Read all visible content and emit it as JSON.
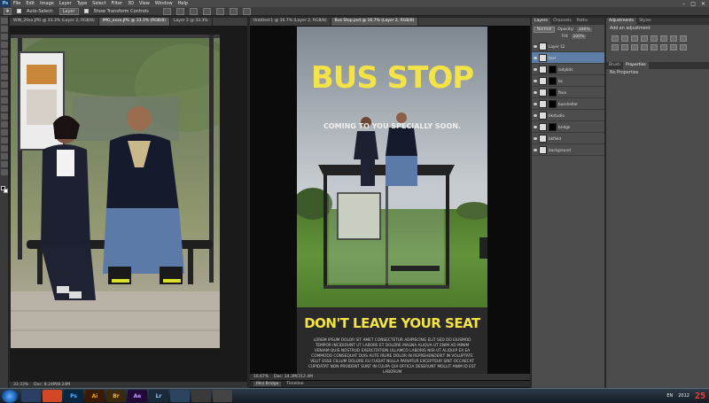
{
  "menubar": {
    "app_logo": "Ps",
    "items": [
      "File",
      "Edit",
      "Image",
      "Layer",
      "Type",
      "Select",
      "Filter",
      "3D",
      "View",
      "Window",
      "Help"
    ],
    "controls": [
      "–",
      "□",
      "✕"
    ]
  },
  "options_bar": {
    "auto_select_label": "Auto-Select:",
    "auto_select_value": "Layer",
    "transform_label": "Show Transform Controls"
  },
  "doc1": {
    "tabs": [
      "WIN_20xx.JPG @ 33.3% (Layer 2, RGB/8)",
      "IMG_xxxx.JPG @ 33.3% (RGB/8)",
      "Layer 2 @ 33.3%"
    ],
    "status": [
      "33.33%",
      "Doc: 8.24M/8.24M"
    ]
  },
  "doc2": {
    "tabs": [
      "Untitled-1 @ 16.7% (Layer 2, RGB/8)",
      "Bus Stop.psd @ 16.7% (Layer 2, RGB/8)"
    ],
    "status": [
      "16.67%",
      "Doc: 34.3M/312.4M"
    ],
    "bottom_tabs": [
      "Mini Bridge",
      "Timeline"
    ]
  },
  "poster": {
    "title": "BUS STOP",
    "tagline": "COMING TO YOU SPECIALLY SOON.",
    "subtitle": "DON'T LEAVE YOUR SEAT",
    "body": "LOREM IPSUM DOLOR SIT AMET CONSECTETUR ADIPISCING ELIT SED DO EIUSMOD TEMPOR INCIDIDUNT UT LABORE ET DOLORE MAGNA ALIQUA UT ENIM AD MINIM VENIAM QUIS NOSTRUD EXERCITATION ULLAMCO LABORIS NISI UT ALIQUIP EX EA COMMODO CONSEQUAT DUIS AUTE IRURE DOLOR IN REPREHENDERIT IN VOLUPTATE VELIT ESSE CILLUM DOLORE EU FUGIAT NULLA PARIATUR EXCEPTEUR SINT OCCAECAT CUPIDATAT NON PROIDENT SUNT IN CULPA QUI OFFICIA DESERUNT MOLLIT ANIM ID EST LABORUM"
  },
  "layers_panel": {
    "tabs": [
      "Layers",
      "Channels",
      "Paths"
    ],
    "blend_mode": "Normal",
    "opacity_label": "Opacity:",
    "opacity": "100%",
    "fill_label": "Fill:",
    "fill": "100%",
    "layers": [
      {
        "name": "Layer 12",
        "selected": false,
        "mask": false
      },
      {
        "name": "text",
        "selected": true,
        "mask": false
      },
      {
        "name": "ladybits",
        "selected": false,
        "mask": true
      },
      {
        "name": "bs",
        "selected": false,
        "mask": true
      },
      {
        "name": "floor",
        "selected": false,
        "mask": true
      },
      {
        "name": "busshelter",
        "selected": false,
        "mask": true
      },
      {
        "name": "bkstudio",
        "selected": false,
        "mask": false
      },
      {
        "name": "bridge",
        "selected": false,
        "mask": true
      },
      {
        "name": "bkfield",
        "selected": false,
        "mask": false
      },
      {
        "name": "background",
        "selected": false,
        "mask": false
      }
    ]
  },
  "adjust_panel": {
    "tabs": [
      "Adjustments",
      "Styles"
    ],
    "heading": "Add an adjustment",
    "props_tabs": [
      "Brush",
      "Properties"
    ],
    "props_text": "No Properties"
  },
  "taskbar": {
    "apps": [
      {
        "label": "",
        "bg": "#2a3f63",
        "fg": "#9fd1ff"
      },
      {
        "label": "",
        "bg": "#d24726",
        "fg": "#fff"
      },
      {
        "label": "Ps",
        "bg": "#0b2740",
        "fg": "#4fb3ff"
      },
      {
        "label": "Ai",
        "bg": "#3a1a00",
        "fg": "#ff9a1f"
      },
      {
        "label": "Br",
        "bg": "#3a2a10",
        "fg": "#e9b35a"
      },
      {
        "label": "Ae",
        "bg": "#220a38",
        "fg": "#c39aff"
      },
      {
        "label": "Lr",
        "bg": "#1a2a3a",
        "fg": "#9dc8ea"
      },
      {
        "label": "",
        "bg": "#2c4460",
        "fg": "#fff"
      },
      {
        "label": "",
        "bg": "#3a3a3a",
        "fg": "#fff"
      },
      {
        "label": "",
        "bg": "#444",
        "fg": "#fff"
      }
    ],
    "tray": "EN",
    "time_small": "2012",
    "time_big": "25"
  }
}
